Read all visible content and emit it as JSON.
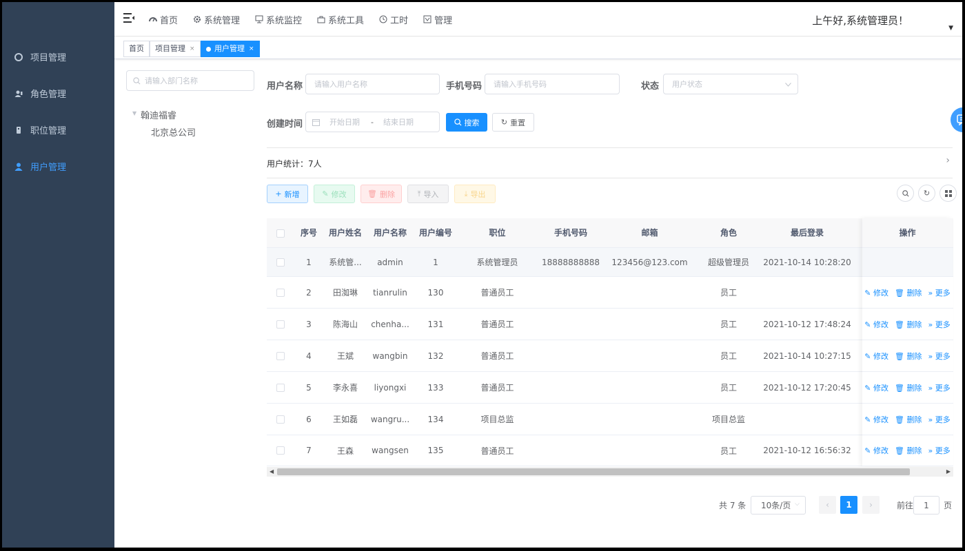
{
  "sidebar": {
    "items": [
      {
        "label": "项目管理",
        "icon": "project-icon"
      },
      {
        "label": "角色管理",
        "icon": "role-icon"
      },
      {
        "label": "职位管理",
        "icon": "position-icon"
      },
      {
        "label": "用户管理",
        "icon": "user-icon"
      }
    ],
    "active_index": 3
  },
  "topnav": {
    "items": [
      {
        "label": "首页",
        "icon": "dashboard-icon"
      },
      {
        "label": "系统管理",
        "icon": "settings-icon"
      },
      {
        "label": "系统监控",
        "icon": "monitor-icon"
      },
      {
        "label": "系统工具",
        "icon": "tool-icon"
      },
      {
        "label": "工时",
        "icon": "clock-icon"
      },
      {
        "label": "管理",
        "icon": "manage-icon"
      }
    ],
    "greeting": "上午好,系统管理员！"
  },
  "tags": [
    {
      "label": "首页",
      "closable": false,
      "active": false
    },
    {
      "label": "项目管理",
      "closable": true,
      "active": false
    },
    {
      "label": "用户管理",
      "closable": true,
      "active": true
    }
  ],
  "dept": {
    "search_placeholder": "请输入部门名称",
    "root": "翰迪福睿",
    "child": "北京总公司"
  },
  "filters": {
    "username_label": "用户名称",
    "username_placeholder": "请输入用户名称",
    "phone_label": "手机号码",
    "phone_placeholder": "请输入手机号码",
    "status_label": "状态",
    "status_placeholder": "用户状态",
    "created_label": "创建时间",
    "start_placeholder": "开始日期",
    "date_sep": "-",
    "end_placeholder": "结束日期",
    "search_btn": "搜索",
    "reset_btn": "重置"
  },
  "stats": {
    "text": "用户统计：7人"
  },
  "toolbar": {
    "add": "新增",
    "edit": "修改",
    "delete": "删除",
    "import": "导入",
    "export": "导出"
  },
  "table": {
    "headers": [
      "序号",
      "用户姓名",
      "用户名称",
      "用户编号",
      "职位",
      "手机号码",
      "邮箱",
      "角色",
      "最后登录",
      "操作"
    ],
    "rows": [
      {
        "no": "1",
        "name": "系统管...",
        "username": "admin",
        "code": "1",
        "position": "系统管理员",
        "phone": "18888888888",
        "email": "123456@123.com",
        "role": "超级管理员",
        "last_login": "2021-10-14 10:28:20",
        "ops": false
      },
      {
        "no": "2",
        "name": "田洳琳",
        "username": "tianrulin",
        "code": "130",
        "position": "普通员工",
        "phone": "",
        "email": "",
        "role": "员工",
        "last_login": "",
        "ops": true
      },
      {
        "no": "3",
        "name": "陈海山",
        "username": "chenha...",
        "code": "131",
        "position": "普通员工",
        "phone": "",
        "email": "",
        "role": "员工",
        "last_login": "2021-10-12 17:48:24",
        "ops": true
      },
      {
        "no": "4",
        "name": "王斌",
        "username": "wangbin",
        "code": "132",
        "position": "普通员工",
        "phone": "",
        "email": "",
        "role": "员工",
        "last_login": "2021-10-14 10:27:15",
        "ops": true
      },
      {
        "no": "5",
        "name": "李永喜",
        "username": "liyongxi",
        "code": "133",
        "position": "普通员工",
        "phone": "",
        "email": "",
        "role": "员工",
        "last_login": "2021-10-12 17:20:45",
        "ops": true
      },
      {
        "no": "6",
        "name": "王如磊",
        "username": "wangru...",
        "code": "134",
        "position": "项目总监",
        "phone": "",
        "email": "",
        "role": "项目总监",
        "last_login": "",
        "ops": true
      },
      {
        "no": "7",
        "name": "王森",
        "username": "wangsen",
        "code": "135",
        "position": "普通员工",
        "phone": "",
        "email": "",
        "role": "员工",
        "last_login": "2021-10-12 16:56:32",
        "ops": true
      }
    ],
    "op_edit": "修改",
    "op_delete": "删除",
    "op_more": "更多"
  },
  "pagination": {
    "total": "共 7 条",
    "page_size": "10条/页",
    "current": "1",
    "goto_prefix": "前往",
    "goto_value": "1",
    "goto_suffix": "页"
  }
}
